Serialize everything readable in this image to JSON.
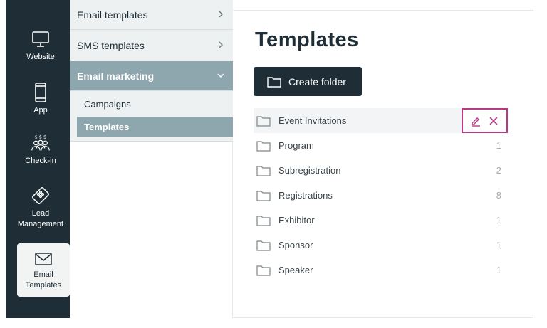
{
  "rail": {
    "items": [
      {
        "label": "Website",
        "icon": "monitor-icon"
      },
      {
        "label": "App",
        "icon": "phone-icon"
      },
      {
        "label": "Check-in",
        "icon": "people-icon"
      },
      {
        "label": "Lead\nManagement",
        "icon": "lead-tag-icon"
      },
      {
        "label": "Email\nTemplates",
        "icon": "envelope-icon",
        "active": true
      }
    ]
  },
  "submenu": {
    "items": [
      {
        "label": "Email templates"
      },
      {
        "label": "SMS templates"
      },
      {
        "label": "Email marketing",
        "expanded": true
      }
    ],
    "children": [
      {
        "label": "Campaigns"
      },
      {
        "label": "Templates",
        "active": true
      }
    ]
  },
  "main": {
    "title": "Templates",
    "create_folder_label": "Create folder",
    "folders": [
      {
        "name": "Event Invitations",
        "count": ""
      },
      {
        "name": "Program",
        "count": "1"
      },
      {
        "name": "Subregistration",
        "count": "2"
      },
      {
        "name": "Registrations",
        "count": "8"
      },
      {
        "name": "Exhibitor",
        "count": "1"
      },
      {
        "name": "Sponsor",
        "count": "1"
      },
      {
        "name": "Speaker",
        "count": "1"
      }
    ]
  },
  "colors": {
    "rail_bg": "#1f2e36",
    "accent": "#8ea6ad",
    "action_highlight": "#b63b84"
  }
}
